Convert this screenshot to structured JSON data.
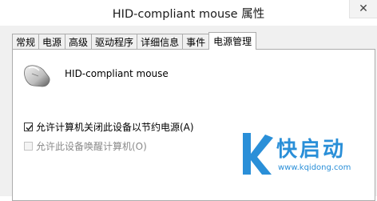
{
  "window": {
    "title": "HID-compliant mouse 属性",
    "close_glyph": "✕"
  },
  "tabs": [
    {
      "label": "常规"
    },
    {
      "label": "电源"
    },
    {
      "label": "高级"
    },
    {
      "label": "驱动程序"
    },
    {
      "label": "详细信息"
    },
    {
      "label": "事件"
    },
    {
      "label": "电源管理",
      "active": true
    }
  ],
  "device": {
    "name": "HID-compliant mouse",
    "icon": "mouse-icon"
  },
  "options": {
    "allow_turn_off": {
      "label": "允许计算机关闭此设备以节约电源(A)",
      "checked": true
    },
    "allow_wake": {
      "label": "允许此设备唤醒计算机(O)",
      "checked": false,
      "disabled": true
    }
  },
  "watermark": {
    "brand": "快启动",
    "url": "www.kqidong.com",
    "color": "#2a8fd8"
  }
}
